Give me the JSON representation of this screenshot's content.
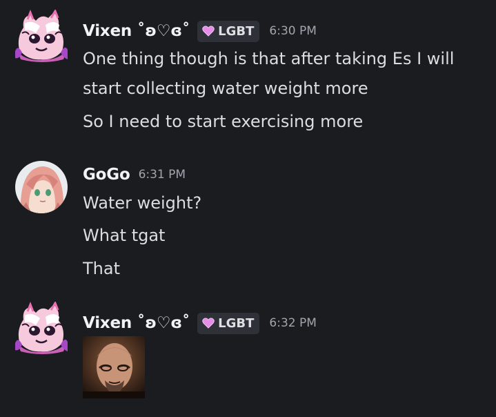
{
  "messages": [
    {
      "author": "Vixen ˚ʚ♡ɞ˚",
      "tag": "LGBT",
      "time": "6:30 PM",
      "lines": [
        "One thing though is that after taking Es I will",
        "start collecting water weight more",
        "So I need to start exercising more"
      ]
    },
    {
      "author": "GoGo",
      "time": "6:31 PM",
      "lines": [
        "Water weight?",
        "What tgat",
        "That"
      ]
    },
    {
      "author": "Vixen ˚ʚ♡ɞ˚",
      "tag": "LGBT",
      "time": "6:32 PM",
      "lines": []
    }
  ],
  "icons": {
    "tag_icon": "heart-icon",
    "tag_color": "#e48ee8"
  }
}
